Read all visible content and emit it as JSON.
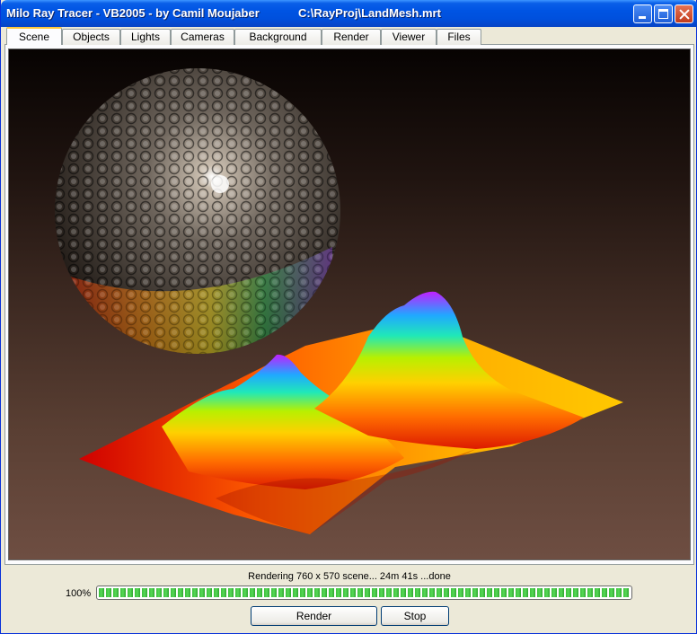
{
  "window": {
    "title": "Milo Ray Tracer - VB2005 - by Camil Moujaber",
    "file_path": "C:\\RayProj\\LandMesh.mrt",
    "controls": {
      "minimize": "minimize-icon",
      "maximize": "maximize-icon",
      "close": "close-icon"
    }
  },
  "tabs": [
    {
      "label": "Scene",
      "active": true
    },
    {
      "label": "Objects"
    },
    {
      "label": "Lights"
    },
    {
      "label": "Cameras"
    },
    {
      "label": "Background"
    },
    {
      "label": "Render"
    },
    {
      "label": "Viewer"
    },
    {
      "label": "Files"
    }
  ],
  "status": {
    "message": "Rendering 760 x 570 scene... 24m 41s ...done",
    "progress_label": "100%",
    "progress_value": 1.0,
    "accent_color": "#3bbf3b"
  },
  "buttons": {
    "render_label": "Render",
    "stop_label": "Stop"
  }
}
